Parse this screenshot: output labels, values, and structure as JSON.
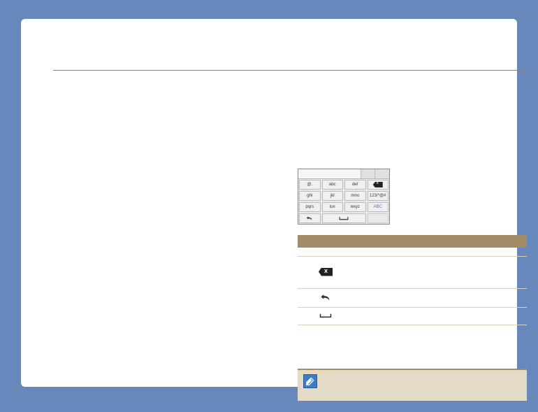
{
  "keypad": {
    "keys": [
      {
        "label": "@."
      },
      {
        "label": "abc"
      },
      {
        "label": "def"
      },
      {
        "icon": "backspace"
      },
      {
        "label": "ghi"
      },
      {
        "label": "jkl"
      },
      {
        "label": "mno"
      },
      {
        "label": "123/*@#"
      },
      {
        "label": "pqrs"
      },
      {
        "label": "tuv"
      },
      {
        "label": "wxyz"
      },
      {
        "label": "ABC",
        "blue": true
      },
      {
        "icon": "undo"
      },
      {
        "icon": "space",
        "wide": true
      },
      {
        "empty": true
      }
    ]
  },
  "table": {
    "header": {
      "c1": "",
      "c2": ""
    },
    "rows": [
      {
        "key": "",
        "desc": ""
      },
      {
        "icon": "backspace",
        "desc": ""
      },
      {
        "icon": "undo",
        "desc": ""
      },
      {
        "icon": "space",
        "desc": ""
      }
    ]
  },
  "note": {
    "text": ""
  }
}
